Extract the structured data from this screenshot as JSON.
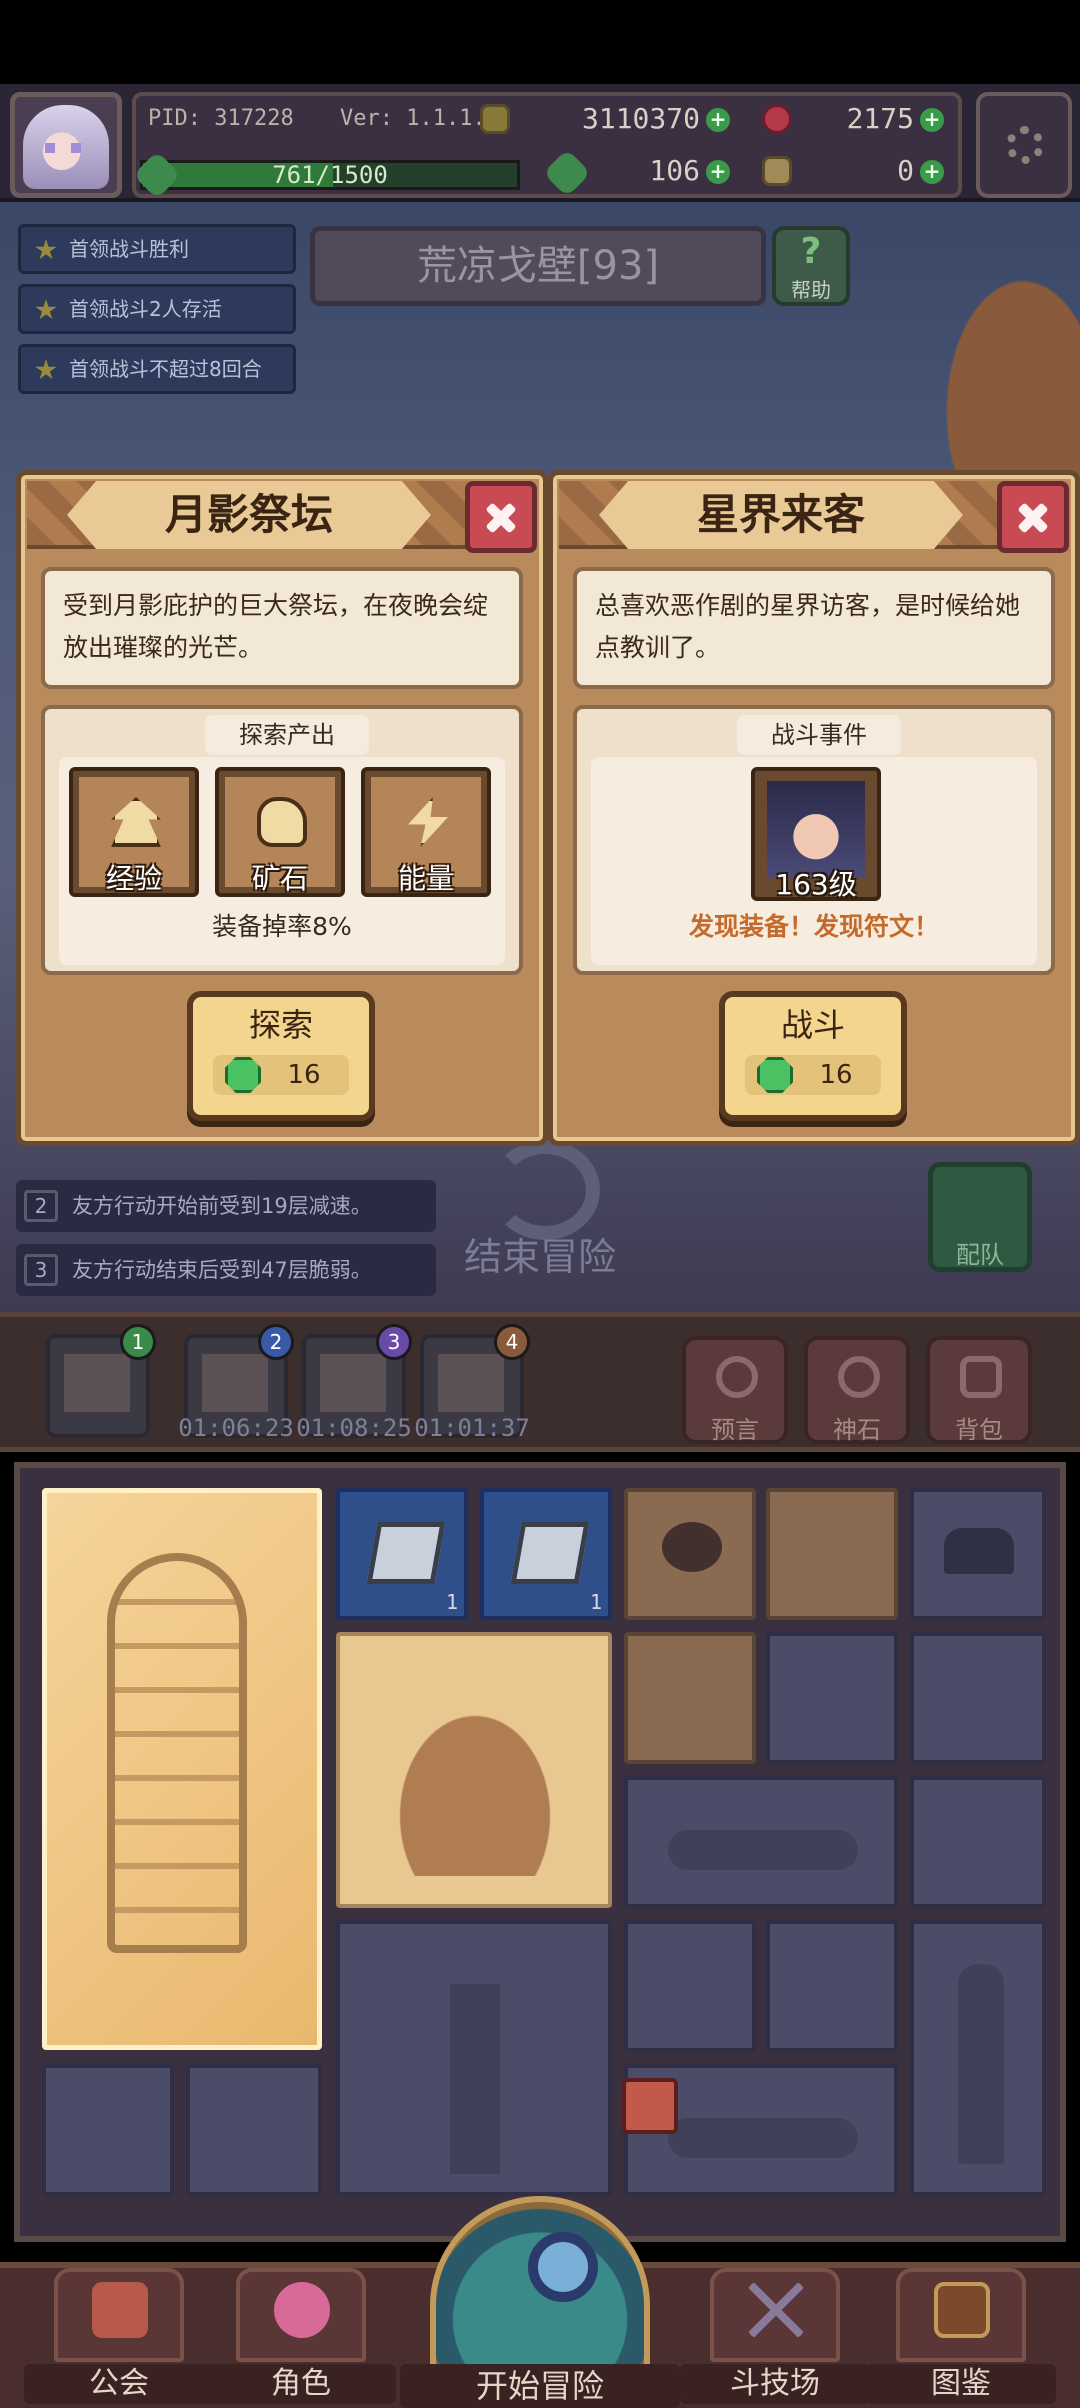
{
  "top_bar": {
    "pid": "PID: 317228",
    "version": "Ver: 1.1.1.4",
    "gold": "3110370",
    "ruby": "2175",
    "clover": "106",
    "key": "0",
    "xp_text": "761/1500",
    "xp_progress": 0.507
  },
  "quests": [
    {
      "label": "首领战斗胜利"
    },
    {
      "label": "首领战斗2人存活"
    },
    {
      "label": "首领战斗不超过8回合"
    }
  ],
  "region": {
    "title": "荒凉戈壁[93]",
    "help_label": "帮助",
    "help_symbol": "?"
  },
  "card_left": {
    "title": "月影祭坛",
    "description": "受到月影庇护的巨大祭坛，在夜晚会绽放出璀璨的光芒。",
    "section_label": "探索产出",
    "products": [
      {
        "label": "经验",
        "icon": "arrow-up-icon"
      },
      {
        "label": "矿石",
        "icon": "ore-icon"
      },
      {
        "label": "能量",
        "icon": "lightning-icon"
      }
    ],
    "note": "装备掉率8%",
    "button_label": "探索",
    "cost": "16"
  },
  "card_right": {
    "title": "星界来客",
    "description": "总喜欢恶作剧的星界访客，是时候给她点教训了。",
    "section_label": "战斗事件",
    "enemy_level": "163级",
    "note": "发现装备！发现符文！",
    "button_label": "战斗",
    "cost": "16"
  },
  "battle_log": [
    {
      "num": "2",
      "text": "友方行动开始前受到19层减速。"
    },
    {
      "num": "3",
      "text": "友方行动结束后受到47层脆弱。"
    }
  ],
  "end_adventure_label": "结束冒险",
  "team_label": "配队",
  "queue": [
    {
      "badge": "1",
      "time": "",
      "badge_color": "#3a8a4a"
    },
    {
      "badge": "2",
      "time": "01:06:23",
      "badge_color": "#3a5aa8"
    },
    {
      "badge": "3",
      "time": "01:08:25",
      "badge_color": "#6a4aa8"
    },
    {
      "badge": "4",
      "time": "01:01:37",
      "badge_color": "#8a5a3a"
    }
  ],
  "tools": [
    {
      "label": "预言",
      "icon": "crystal-ball-icon"
    },
    {
      "label": "神石",
      "icon": "stone-icon"
    },
    {
      "label": "背包",
      "icon": "backpack-icon"
    }
  ],
  "inventory": {
    "block_count_1": "1",
    "block_count_2": "1"
  },
  "bottom_nav": [
    {
      "label": "公会",
      "icon": "guild-icon"
    },
    {
      "label": "角色",
      "icon": "character-icon"
    },
    {
      "label": "开始冒险",
      "icon": "magnifier-icon"
    },
    {
      "label": "斗技场",
      "icon": "swords-icon"
    },
    {
      "label": "图鉴",
      "icon": "book-icon"
    }
  ],
  "colors": {
    "card_bg": "#b98a5c",
    "accent_orange": "#c46a2a",
    "gem_green": "#4ac262",
    "close_red": "#c84a52"
  }
}
